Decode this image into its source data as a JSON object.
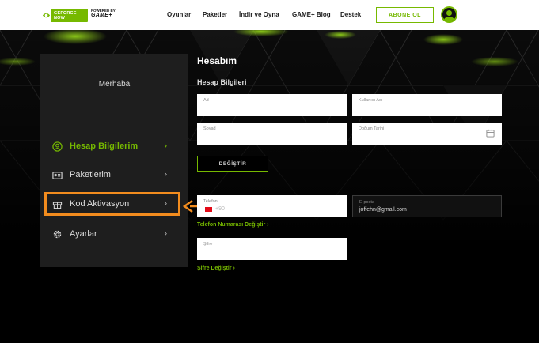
{
  "header": {
    "logo_text_line1": "GEFORCE",
    "logo_text_line2": "NOW",
    "powered_by": "POWERED BY",
    "partner": "GAME+",
    "nav": [
      "Oyunlar",
      "Paketler",
      "İndir ve Oyna",
      "GAME+ Blog",
      "Destek"
    ],
    "subscribe_label": "ABONE OL"
  },
  "sidebar": {
    "greeting": "Merhaba",
    "items": [
      {
        "label": "Hesap Bilgilerim",
        "icon": "user-circle-icon",
        "active": true
      },
      {
        "label": "Paketlerim",
        "icon": "id-card-icon",
        "active": false
      },
      {
        "label": "Kod Aktivasyon",
        "icon": "gift-icon",
        "active": false
      },
      {
        "label": "Ayarlar",
        "icon": "gear-icon",
        "active": false
      }
    ],
    "chevron": "›"
  },
  "main": {
    "title": "Hesabım",
    "section_title": "Hesap Bilgileri",
    "fields": {
      "first_name": {
        "label": "Ad",
        "value": ""
      },
      "username": {
        "label": "Kullanıcı Adı",
        "value": ""
      },
      "last_name": {
        "label": "Soyad",
        "value": ""
      },
      "birth_date": {
        "label": "Doğum Tarihi",
        "value": ""
      },
      "phone": {
        "label": "Telefon",
        "value": "",
        "country_code": "+90"
      },
      "email": {
        "label": "E-posta",
        "value": "joffehn@gmail.com"
      },
      "password": {
        "label": "Şifre",
        "value": ""
      }
    },
    "change_button": "DEĞİŞTİR",
    "change_phone_link": "Telefon Numarası Değiştir ›",
    "change_password_link": "Şifre Değiştir ›"
  },
  "colors": {
    "accent": "#76b900",
    "highlight": "#f28c1e",
    "background": "#000000",
    "panel": "#1e1e1e"
  }
}
